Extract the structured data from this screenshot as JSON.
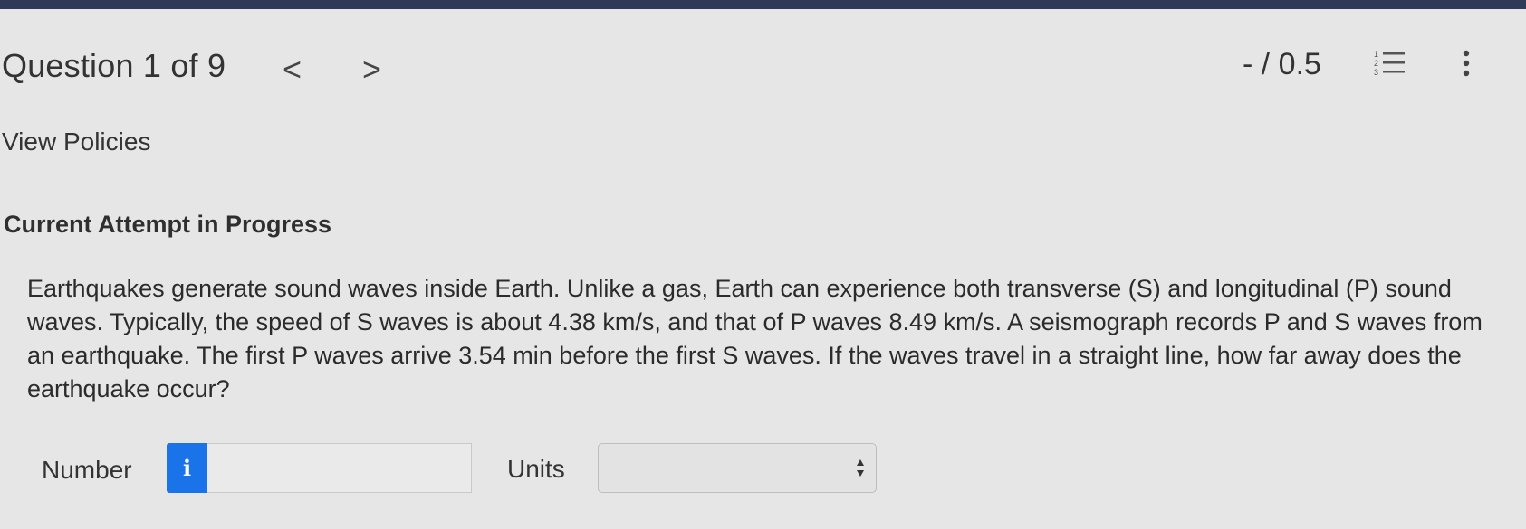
{
  "header": {
    "question_title": "Question 1 of 9",
    "prev_symbol": "<",
    "next_symbol": ">",
    "score": "- / 0.5",
    "list_icon": "numbered-list-icon",
    "more_icon": "vertical-ellipsis-icon"
  },
  "links": {
    "view_policies": "View Policies"
  },
  "attempt": {
    "status": "Current Attempt in Progress"
  },
  "question": {
    "text": "Earthquakes generate sound waves inside Earth. Unlike a gas, Earth can experience both transverse (S) and longitudinal (P) sound waves. Typically, the speed of S waves is about 4.38 km/s, and that of P waves 8.49 km/s. A seismograph records P and S waves from an earthquake. The first P waves arrive 3.54 min before the first S waves. If the waves travel in a straight line, how far away does the earthquake occur?"
  },
  "answer": {
    "number_label": "Number",
    "info_symbol": "i",
    "number_value": "",
    "units_label": "Units",
    "units_value": ""
  },
  "colors": {
    "top_bar": "#2e3a57",
    "background": "#e6e6e6",
    "info_button": "#1a73e8"
  }
}
